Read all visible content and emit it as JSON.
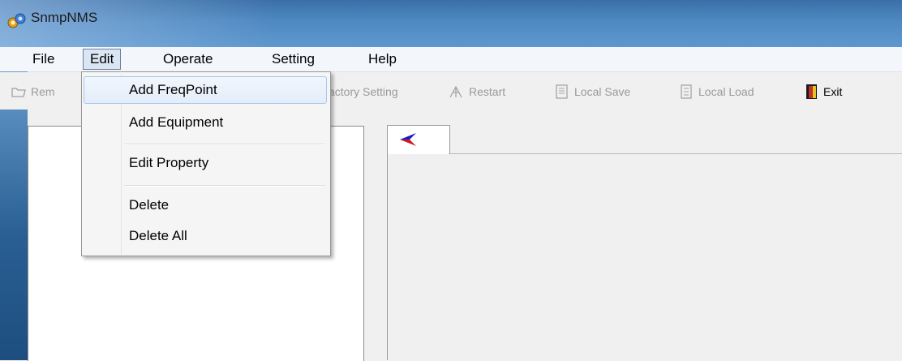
{
  "window": {
    "title": "SnmpNMS"
  },
  "menubar": {
    "items": [
      {
        "label": "File"
      },
      {
        "label": "Edit"
      },
      {
        "label": "Operate"
      },
      {
        "label": "Setting"
      },
      {
        "label": "Help"
      }
    ]
  },
  "toolbar": {
    "buttons": [
      {
        "label": "Rem",
        "icon": "folder-icon",
        "enabled": false
      },
      {
        "label": "actory Setting",
        "enabled": false
      },
      {
        "label": "Restart",
        "icon": "restart-icon",
        "enabled": false
      },
      {
        "label": "Local Save",
        "icon": "save-icon",
        "enabled": false
      },
      {
        "label": "Local Load",
        "icon": "load-icon",
        "enabled": false
      },
      {
        "label": "Exit",
        "icon": "exit-door-icon",
        "enabled": true
      }
    ]
  },
  "edit_menu": {
    "items": [
      {
        "label": "Add FreqPoint"
      },
      {
        "label": "Add Equipment"
      },
      {
        "label": "Edit Property"
      },
      {
        "label": "Delete"
      },
      {
        "label": "Delete All"
      }
    ]
  },
  "tabs": [
    {
      "icon": "back-arrow-icon"
    }
  ],
  "colors": {
    "titlebar": "#4f89c2",
    "menu_hover_border": "#a8c7ee",
    "arrow_blue": "#1a1ad0",
    "arrow_red": "#d01a1a"
  }
}
